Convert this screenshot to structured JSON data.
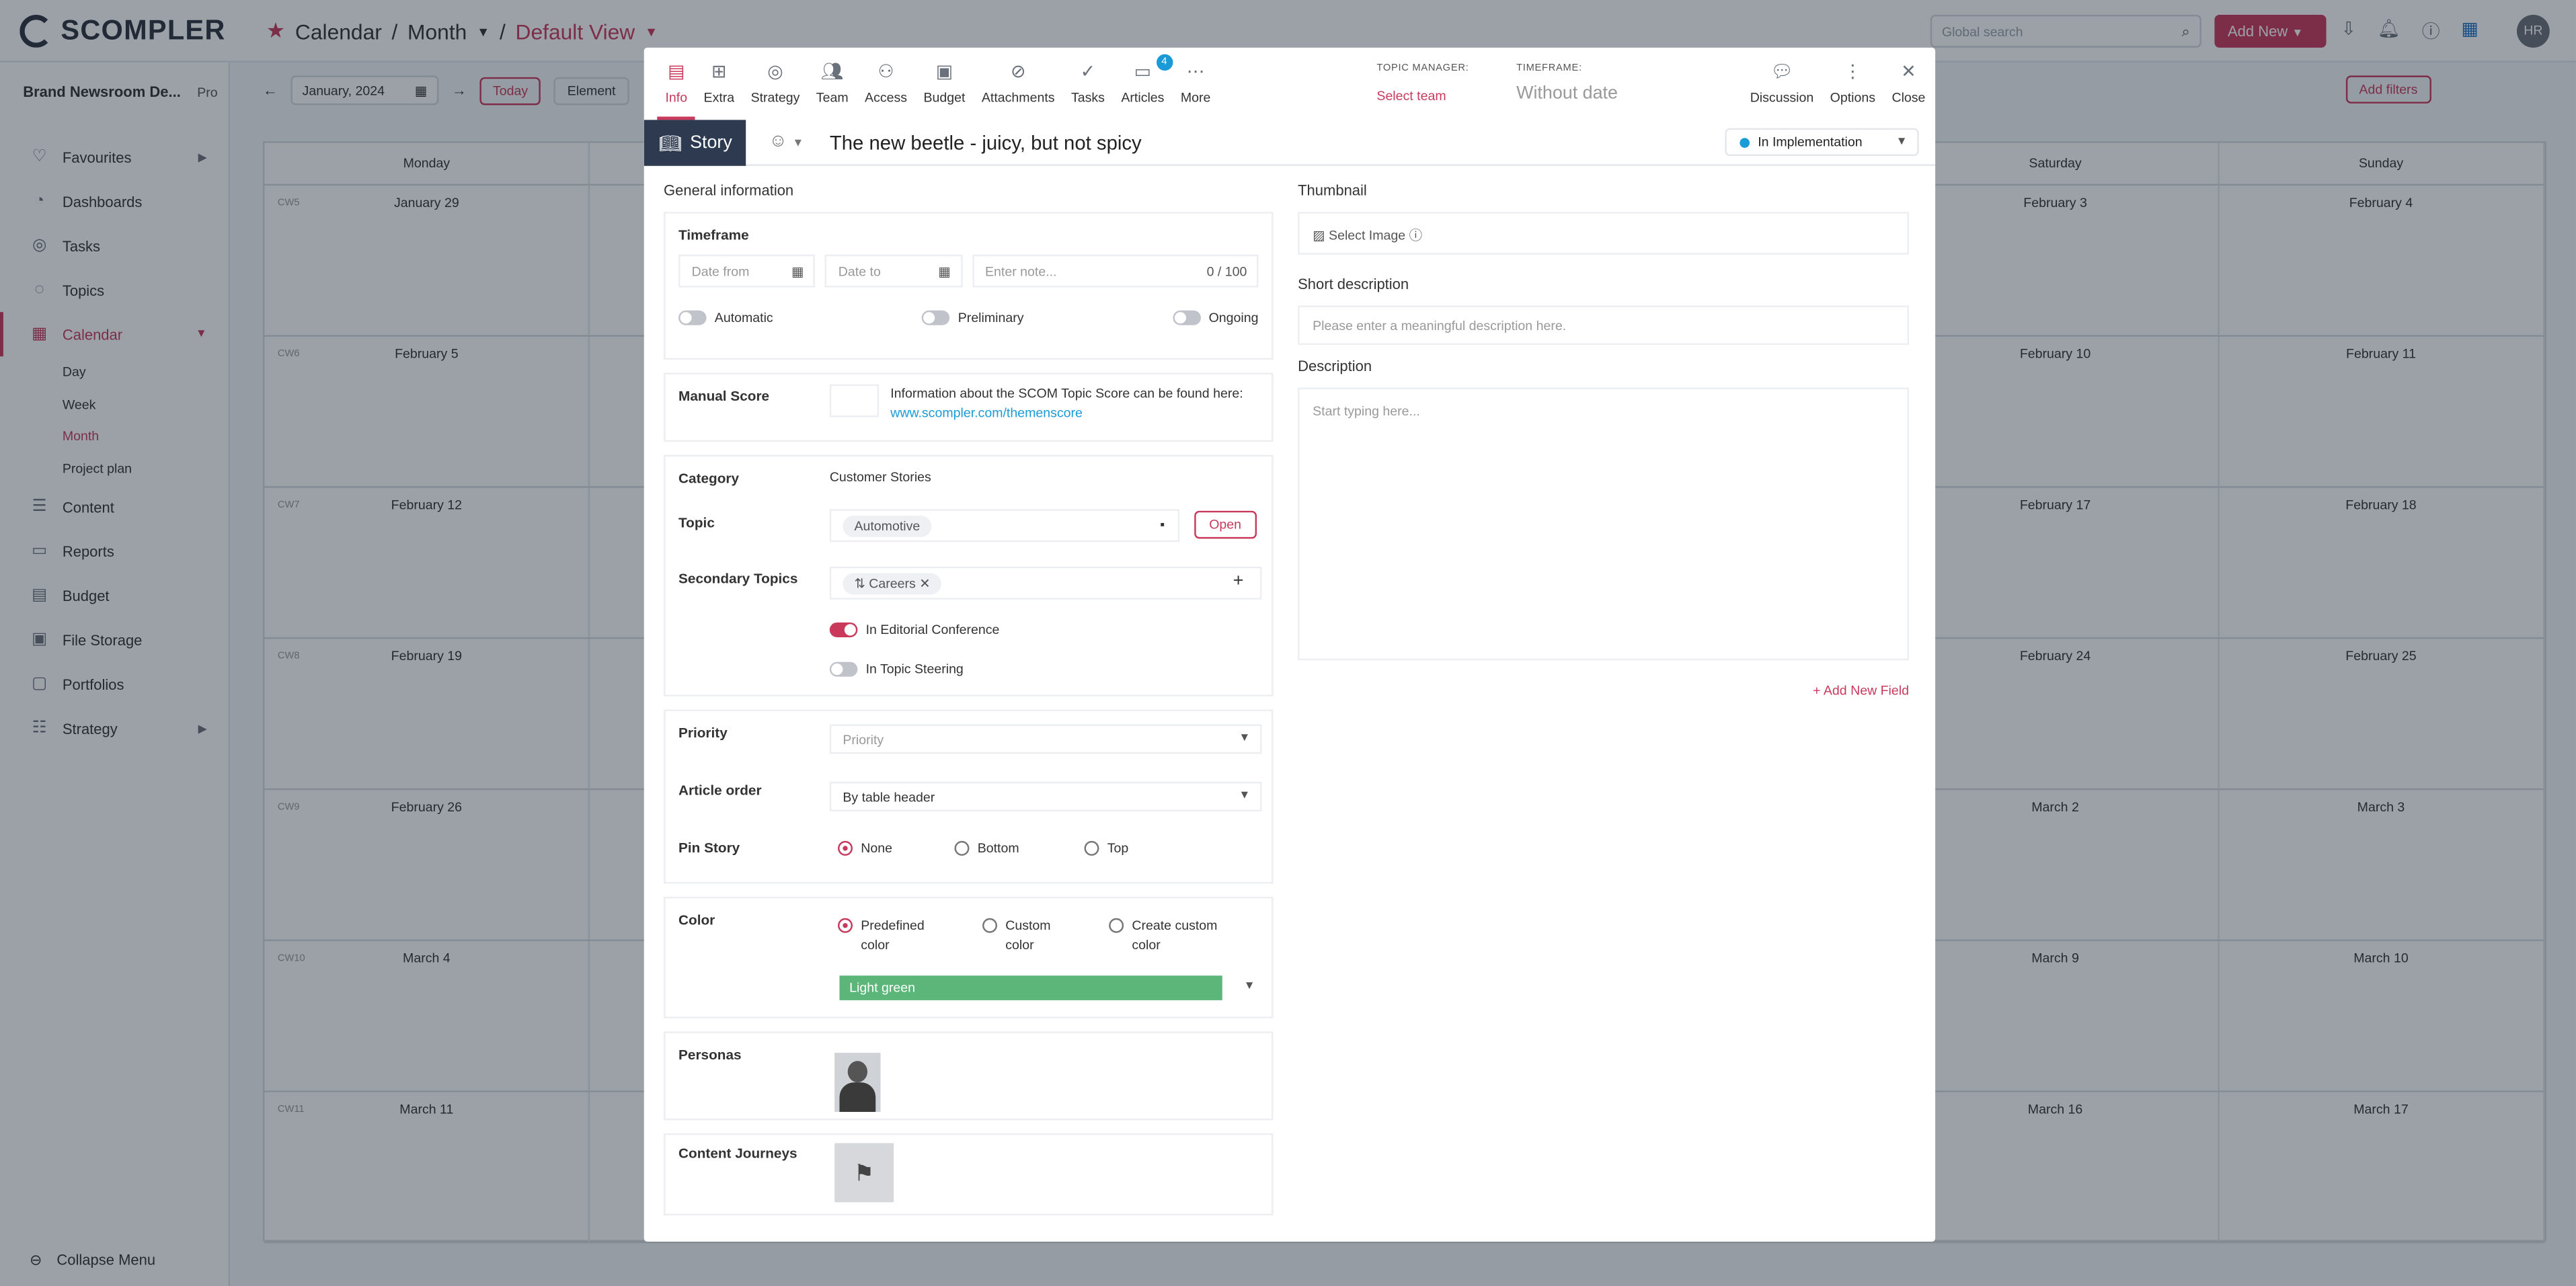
{
  "app": {
    "logo": "SCOMPLER",
    "breadcrumb": [
      "Calendar",
      "Month",
      "Default View"
    ],
    "search_placeholder": "Global search",
    "add_new": "Add New",
    "user_initials": "HR"
  },
  "sidebar": {
    "brand": "Brand Newsroom De...",
    "plan": "Pro",
    "items": [
      {
        "label": "Favourites",
        "icon": "heart-icon"
      },
      {
        "label": "Dashboards",
        "icon": "dashboard-icon"
      },
      {
        "label": "Tasks",
        "icon": "check-circle-icon"
      },
      {
        "label": "Topics",
        "icon": "lightbulb-icon"
      },
      {
        "label": "Calendar",
        "icon": "calendar-icon"
      },
      {
        "label": "Content",
        "icon": "content-icon"
      },
      {
        "label": "Reports",
        "icon": "monitor-icon"
      },
      {
        "label": "Budget",
        "icon": "budget-icon"
      },
      {
        "label": "File Storage",
        "icon": "folder-icon"
      },
      {
        "label": "Portfolios",
        "icon": "portfolio-icon"
      },
      {
        "label": "Strategy",
        "icon": "sliders-icon"
      }
    ],
    "calendar_sub": [
      "Day",
      "Week",
      "Month",
      "Project plan"
    ],
    "collapse": "Collapse Menu"
  },
  "calendar": {
    "month": "January, 2024",
    "today": "Today",
    "elements": "Element",
    "add_filters": "Add filters",
    "days": [
      "Monday",
      "",
      "",
      "",
      "",
      "Saturday",
      "Sunday"
    ],
    "rows": [
      {
        "cw": "CW5",
        "mon": "January 29",
        "sat": "February 3",
        "sun": "February 4"
      },
      {
        "cw": "CW6",
        "mon": "February 5",
        "sat": "February 10",
        "sun": "February 11"
      },
      {
        "cw": "CW7",
        "mon": "February 12",
        "sat": "February 17",
        "sun": "February 18"
      },
      {
        "cw": "CW8",
        "mon": "February 19",
        "sat": "February 24",
        "sun": "February 25"
      },
      {
        "cw": "CW9",
        "mon": "February 26",
        "sat": "March 2",
        "sun": "March 3"
      },
      {
        "cw": "CW10",
        "mon": "March 4",
        "sat": "March 9",
        "sun": "March 10"
      },
      {
        "cw": "CW11",
        "mon": "March 11",
        "sat": "March 16",
        "sun": "March 17"
      }
    ]
  },
  "modal": {
    "tabs": [
      {
        "label": "Info",
        "icon": "info-doc-icon"
      },
      {
        "label": "Extra",
        "icon": "extra-icon"
      },
      {
        "label": "Strategy",
        "icon": "target-icon"
      },
      {
        "label": "Team",
        "icon": "team-icon"
      },
      {
        "label": "Access",
        "icon": "access-icon"
      },
      {
        "label": "Budget",
        "icon": "budget-icon"
      },
      {
        "label": "Attachments",
        "icon": "paperclip-icon"
      },
      {
        "label": "Tasks",
        "icon": "check-circle-icon"
      },
      {
        "label": "Articles",
        "icon": "folder-icon",
        "badge": "4"
      },
      {
        "label": "More",
        "icon": "ellipsis-icon"
      }
    ],
    "topic_manager_label": "TOPIC MANAGER:",
    "topic_manager_value": "Select team",
    "timeframe_label": "TIMEFRAME:",
    "timeframe_value": "Without date",
    "actions": [
      {
        "label": "Discussion",
        "icon": "chat-icon"
      },
      {
        "label": "Options",
        "icon": "kebab-icon"
      },
      {
        "label": "Close",
        "icon": "close-icon"
      }
    ],
    "type": "Story",
    "title": "The new beetle - juicy, but not spicy",
    "status": "In Implementation",
    "status_color": "#1a9bd7",
    "general_info": "General information",
    "timeframe": {
      "label": "Timeframe",
      "date_from": "Date from",
      "date_to": "Date to",
      "note_placeholder": "Enter note...",
      "note_count": "0 / 100",
      "automatic": "Automatic",
      "preliminary": "Preliminary",
      "ongoing": "Ongoing"
    },
    "manual_score": {
      "label": "Manual Score",
      "info": "Information about the SCOM Topic Score can be found here:",
      "link": "www.scompler.com/themenscore"
    },
    "category": {
      "label": "Category",
      "value": "Customer Stories"
    },
    "topic": {
      "label": "Topic",
      "value": "Automotive",
      "open": "Open"
    },
    "secondary_topics": {
      "label": "Secondary Topics",
      "value": "Careers",
      "editorial": "In Editorial Conference",
      "steering": "In Topic Steering"
    },
    "priority": {
      "label": "Priority",
      "placeholder": "Priority"
    },
    "article_order": {
      "label": "Article order",
      "value": "By table header"
    },
    "pin_story": {
      "label": "Pin Story",
      "options": [
        "None",
        "Bottom",
        "Top"
      ]
    },
    "color": {
      "label": "Color",
      "options": [
        "Predefined color",
        "Custom color",
        "Create custom color"
      ],
      "selected": "Light green",
      "selected_hex": "#5cb67a"
    },
    "personas": {
      "label": "Personas"
    },
    "content_journeys": {
      "label": "Content Journeys"
    },
    "thumbnail": {
      "label": "Thumbnail",
      "select": "Select Image"
    },
    "short_description": {
      "label": "Short description",
      "placeholder": "Please enter a meaningful description here."
    },
    "description": {
      "label": "Description",
      "placeholder": "Start typing here..."
    },
    "add_field": "Add New Field"
  }
}
